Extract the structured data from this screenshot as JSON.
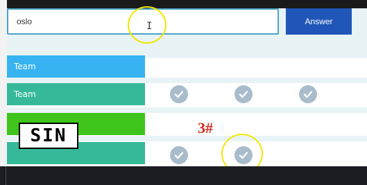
{
  "answer_form": {
    "input_value": "oslo",
    "answer_button_label": "Answer"
  },
  "board": {
    "rows": [
      {
        "team_label": "Team",
        "color": "#36b3f0",
        "checks": [
          false,
          false,
          false
        ]
      },
      {
        "team_label": "Team",
        "color": "#35b999",
        "checks": [
          true,
          true,
          true
        ]
      },
      {
        "team_label": "",
        "color": "#3fc41b",
        "checks": [
          false,
          false,
          false
        ]
      },
      {
        "team_label": "",
        "color": "#35b999",
        "checks": [
          true,
          true,
          false
        ]
      }
    ]
  },
  "overlay": {
    "score_label": "3#",
    "badge_text": "SIN",
    "accent_color": "#d42a1e",
    "highlight_color": "#f2e600"
  },
  "icons": {
    "check": "check-circle-icon",
    "text_cursor": "text-cursor-icon"
  }
}
